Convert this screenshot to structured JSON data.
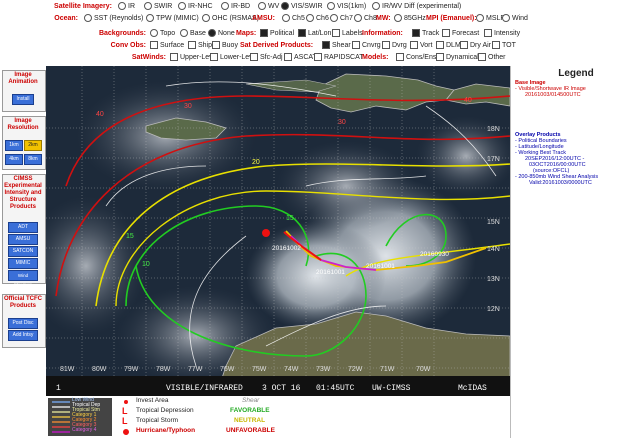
{
  "controls": {
    "satellite_imagery": {
      "label": "Satellite Imagery:",
      "options": [
        "IR",
        "SWIR",
        "IR-NHC",
        "IR-BD",
        "WV",
        "VIS/SWIR",
        "VIS(1km)",
        "IR/WV Diff (experimental)"
      ]
    },
    "ocean": {
      "label": "Ocean:",
      "options": [
        "SST (Reynolds)",
        "TPW (MIMIC)",
        "OHC (RSMAS)"
      ],
      "amsu_label": "AMSU:",
      "amsu_options": [
        "Ch5",
        "Ch6",
        "Ch7",
        "Ch8"
      ],
      "mw_label": "MW:",
      "mw_options": [
        "85GHz"
      ],
      "mpi_label": "MPI (Emanuel):",
      "mpi_options": [
        "MSLP",
        "Wind"
      ]
    },
    "backgrounds": {
      "label": "Backgrounds:",
      "options": [
        "Topo",
        "Base",
        "None"
      ],
      "maps_label": "Maps:",
      "maps_options": [
        "Political",
        "Lat/Lon",
        "Labels"
      ],
      "info_label": "Information:",
      "info_options": [
        "Track",
        "Forecast",
        "Intensity"
      ]
    },
    "conv_obs": {
      "label": "Conv Obs:",
      "options": [
        "Surface",
        "Ship",
        "Buoy"
      ],
      "sat_derived_label": "Sat Derived Products:",
      "sat_derived_options": [
        "Shear",
        "Cnvrg",
        "Dvrg",
        "Vort",
        "DLM",
        "Dry Air",
        "TOT"
      ]
    },
    "satwinds": {
      "label": "SatWinds:",
      "options": [
        "Upper-Lev",
        "Lower-Lev",
        "Sfc-Adj",
        "ASCAT",
        "RAPIDSCAT"
      ],
      "models_label": "Models:",
      "models_options": [
        "Cons/Ens",
        "Dynamical",
        "Other"
      ]
    }
  },
  "left_panel": {
    "animation_title": "Image Animation",
    "install_button": "Install",
    "resolution_title": "Image Resolution",
    "res_buttons": [
      "1km",
      "2km",
      "4km",
      "8km"
    ],
    "cimss_title": "CIMSS Experimental Intensity and Structure Products",
    "cimss_buttons": [
      "ADT",
      "AMSU",
      "SATCON",
      "MIMIC",
      "Wind Structure"
    ],
    "tcfc_title": "Official TCFC Products",
    "tcfc_buttons": [
      "Post Disc",
      "Add Intsy"
    ]
  },
  "map": {
    "lat_labels": [
      "18N",
      "17N",
      "15N",
      "14N",
      "13N",
      "12N"
    ],
    "lon_labels": [
      "81W",
      "80W",
      "79W",
      "78W",
      "77W",
      "76W",
      "75W",
      "74W",
      "73W",
      "72W",
      "71W",
      "70W"
    ],
    "shear_labels": [
      "40",
      "30",
      "20",
      "15",
      "10",
      "15",
      "30",
      "40"
    ],
    "track_labels": [
      "20161002",
      "20161001",
      "20161001",
      "20160930"
    ],
    "footer_frame": "1",
    "footer_product": "VISIBLE/INFRARED",
    "footer_date": "3 OCT 16",
    "footer_time": "01:45UTC",
    "footer_source": "UW-CIMSS",
    "footer_tool": "McIDAS"
  },
  "bottom_legend": {
    "line_labels": [
      "Low Wind",
      "Tropical Dep",
      "Tropical Stm",
      "Category 1",
      "Category 2",
      "Category 3",
      "Category 4"
    ],
    "invest_label": "Invest Area",
    "td_label": "Tropical Depression",
    "ts_label": "Tropical Storm",
    "hu_label": "Hurricane/Typhoon",
    "shear_title": "Shear",
    "favorable": "FAVORABLE",
    "neutral": "NEUTRAL",
    "unfavorable": "UNFAVORABLE"
  },
  "right_legend": {
    "title": "Legend",
    "base_image_header": "Base Image",
    "base_image_lines": [
      "- Visible/Shortwave IR Image",
      "20161003/014500UTC"
    ],
    "overlay_header": "Overlay Products",
    "overlay_lines": [
      "- Political Boundaries",
      "- Latitude/Longitude",
      "- Working Best Track",
      "20SEP2016/12:00UTC -",
      "03OCT2016/00:00UTC",
      "(source:OFCL)",
      "- 200-850mb Wind Shear Analysis",
      "Valid:20161003/0000UTC"
    ]
  },
  "colors": {
    "map_bg": "#1d2a3a",
    "shear_red": "#d01010",
    "shear_yellow": "#e8e000",
    "shear_green": "#22cc22",
    "track_red": "#ee1111",
    "track_magenta": "#cc22cc",
    "track_yellow": "#f0c000",
    "header_red": "#cc0000",
    "button_blue": "#3a6fd8",
    "button_yellow": "#f2c200"
  }
}
